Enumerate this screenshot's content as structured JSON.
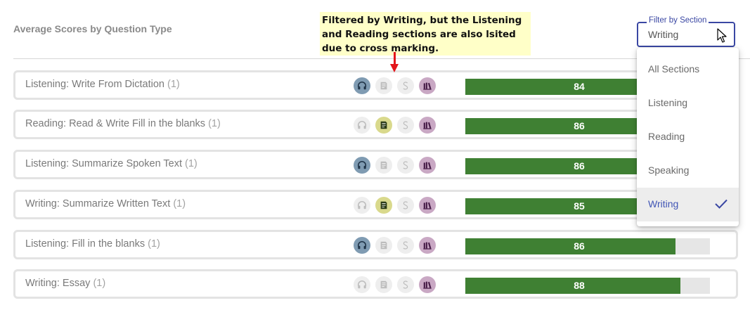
{
  "header": {
    "title": "Average Scores by Question Type"
  },
  "callout": {
    "text": "Filtered by Writing, but the Listening and Reading sections are also lsited due to cross marking."
  },
  "filter": {
    "label": "Filter by Section",
    "value": "Writing",
    "options": [
      "All Sections",
      "Listening",
      "Reading",
      "Speaking",
      "Writing"
    ],
    "selected_index": 4
  },
  "colors": {
    "listening_active": "#7f9bb2",
    "reading_active": "#d9d98c",
    "speaking_active": "#e0e0e0",
    "writing_active": "#c9a8c4",
    "inactive": "#eeeeee",
    "bar_fill": "#3f8033",
    "accent": "#3a47a3"
  },
  "rows": [
    {
      "label": "Listening: Write From Dictation",
      "count": "(1)",
      "score": "84",
      "percent": 84,
      "icons": [
        true,
        false,
        false,
        true
      ]
    },
    {
      "label": "Reading: Read & Write Fill in the blanks",
      "count": "(1)",
      "score": "86",
      "percent": 86,
      "icons": [
        false,
        true,
        false,
        true
      ]
    },
    {
      "label": "Listening: Summarize Spoken Text",
      "count": "(1)",
      "score": "86",
      "percent": 86,
      "icons": [
        true,
        false,
        false,
        true
      ]
    },
    {
      "label": "Writing: Summarize Written Text",
      "count": "(1)",
      "score": "85",
      "percent": 85,
      "icons": [
        false,
        true,
        false,
        true
      ]
    },
    {
      "label": "Listening: Fill in the blanks",
      "count": "(1)",
      "score": "86",
      "percent": 86,
      "icons": [
        true,
        false,
        false,
        true
      ]
    },
    {
      "label": "Writing: Essay",
      "count": "(1)",
      "score": "88",
      "percent": 88,
      "icons": [
        false,
        false,
        false,
        true
      ]
    }
  ],
  "section_icons": [
    "headphones-icon",
    "book-icon",
    "speaking-icon",
    "writing-icon"
  ]
}
